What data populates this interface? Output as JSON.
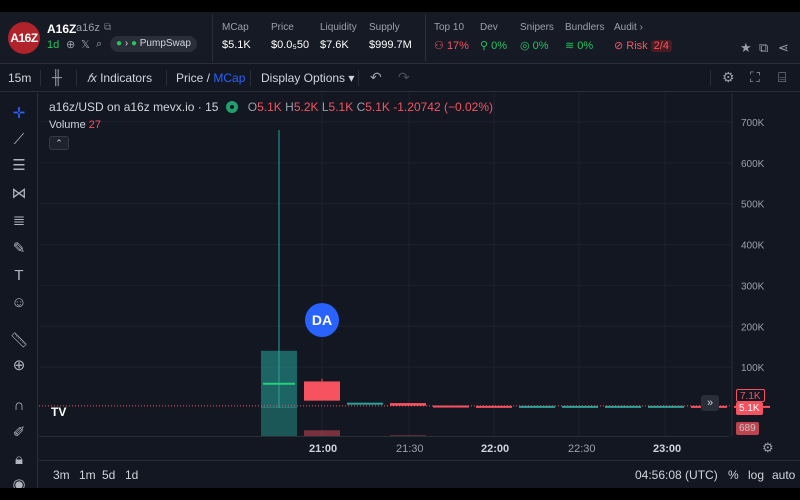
{
  "token": {
    "logo_text": "A16Z",
    "name": "A16Z",
    "ticker": "a16z",
    "age": "1d",
    "dex": "PumpSwap"
  },
  "stats": [
    {
      "label": "MCap",
      "value": "$5.1K"
    },
    {
      "label": "Price",
      "value": "$0.0₅50"
    },
    {
      "label": "Liquidity",
      "value": "$7.6K"
    },
    {
      "label": "Supply",
      "value": "$999.7M"
    }
  ],
  "audit_stats": [
    {
      "label": "Top 10",
      "value": "17%",
      "icon": "users-icon",
      "color": "#f7525f"
    },
    {
      "label": "Dev",
      "value": "0%",
      "icon": "user-icon",
      "color": "#22c55e"
    },
    {
      "label": "Snipers",
      "value": "0%",
      "icon": "target-icon",
      "color": "#22c55e"
    },
    {
      "label": "Bundlers",
      "value": "0%",
      "icon": "layers-icon",
      "color": "#22c55e"
    }
  ],
  "audit": {
    "label": "Audit",
    "risk_label": "Risk",
    "risk_value": "2/4"
  },
  "toolbar": {
    "interval": "15m",
    "indicators": "Indicators",
    "price": "Price",
    "mcap": "MCap",
    "display_options": "Display Options"
  },
  "legend": {
    "symbol": "a16z/USD on a16z mevx.io · 15",
    "o_label": "O",
    "o_value": "5.1K",
    "h_label": "H",
    "h_value": "5.2K",
    "l_label": "L",
    "l_value": "5.1K",
    "c_label": "C",
    "c_value": "5.1K",
    "change": "-1.20742 (−0.02%)",
    "volume_label": "Volume",
    "volume_value": "27"
  },
  "badge": "DA",
  "price_tags": {
    "high": "7.1K",
    "last": "5.1K",
    "volume": "689"
  },
  "bottom": {
    "ranges": [
      "3m",
      "1m",
      "5d",
      "1d"
    ],
    "clock": "04:56:08 (UTC)",
    "percent": "%",
    "log": "log",
    "auto": "auto"
  },
  "colors": {
    "up": "#26a69a",
    "down": "#f7525f",
    "accent": "#2962ff"
  },
  "chart_data": {
    "type": "candlestick",
    "y_axis_labels": [
      "700K",
      "600K",
      "500K",
      "400K",
      "300K",
      "200K",
      "100K"
    ],
    "y_ticks": [
      700000,
      600000,
      500000,
      400000,
      300000,
      200000,
      100000
    ],
    "x_axis_labels": [
      "21:00",
      "21:30",
      "22:00",
      "22:30",
      "23:00"
    ],
    "candles": [
      {
        "o": 0,
        "h": 680000,
        "l": 0,
        "c": 140000,
        "dir": "up",
        "vol": 40
      },
      {
        "o": 65000,
        "h": 72000,
        "l": 20000,
        "c": 18000,
        "dir": "down",
        "vol": 8
      },
      {
        "o": 12000,
        "h": 13000,
        "l": 9000,
        "c": 13000,
        "dir": "up",
        "vol": 0
      },
      {
        "o": 12000,
        "h": 12500,
        "l": 6000,
        "c": 5500,
        "dir": "down",
        "vol": 1
      },
      {
        "o": 6000,
        "h": 6200,
        "l": 5200,
        "c": 5300,
        "dir": "down",
        "vol": 0
      },
      {
        "o": 5300,
        "h": 5500,
        "l": 5000,
        "c": 5200,
        "dir": "down",
        "vol": 0
      },
      {
        "o": 5200,
        "h": 5400,
        "l": 5000,
        "c": 5200,
        "dir": "up",
        "vol": 0
      },
      {
        "o": 5200,
        "h": 5400,
        "l": 5000,
        "c": 5200,
        "dir": "up",
        "vol": 0
      },
      {
        "o": 5200,
        "h": 5500,
        "l": 5000,
        "c": 5200,
        "dir": "up",
        "vol": 0
      },
      {
        "o": 5200,
        "h": 5400,
        "l": 5000,
        "c": 5200,
        "dir": "up",
        "vol": 0
      },
      {
        "o": 5200,
        "h": 5300,
        "l": 5100,
        "c": 5150,
        "dir": "down",
        "vol": 0
      },
      {
        "o": 5150,
        "h": 5200,
        "l": 5050,
        "c": 5100,
        "dir": "down",
        "vol": 0
      }
    ],
    "last_price": 5100,
    "ylim": [
      0,
      720000
    ]
  }
}
